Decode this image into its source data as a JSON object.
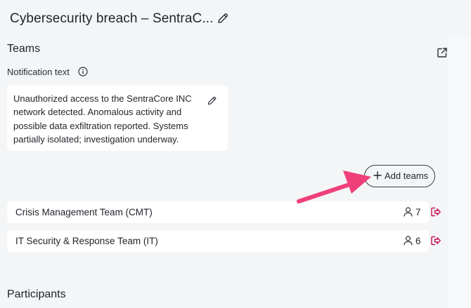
{
  "header": {
    "title": "Cybersecurity breach – SentraC..."
  },
  "teams_section": {
    "title": "Teams",
    "notification_label": "Notification text",
    "notification_text": "Unauthorized access to the SentraCore INC network detected. Anomalous activity and possible data exfiltration reported. Systems partially isolated; investigation underway.",
    "add_teams_label": "Add teams",
    "teams": [
      {
        "name": "Crisis Management Team (CMT)",
        "members": "7"
      },
      {
        "name": "IT Security & Response Team (IT)",
        "members": "6"
      }
    ]
  },
  "participants_section": {
    "title": "Participants"
  },
  "icons": {
    "edit": "pencil-icon",
    "external": "external-link-icon",
    "info": "info-icon",
    "add": "plus-icon",
    "members": "person-icon",
    "leave": "leave-team-icon"
  },
  "colors": {
    "accent_leave": "#c2185b",
    "annotation_arrow": "#f0407a",
    "panel_bg": "#f4f5f6"
  }
}
